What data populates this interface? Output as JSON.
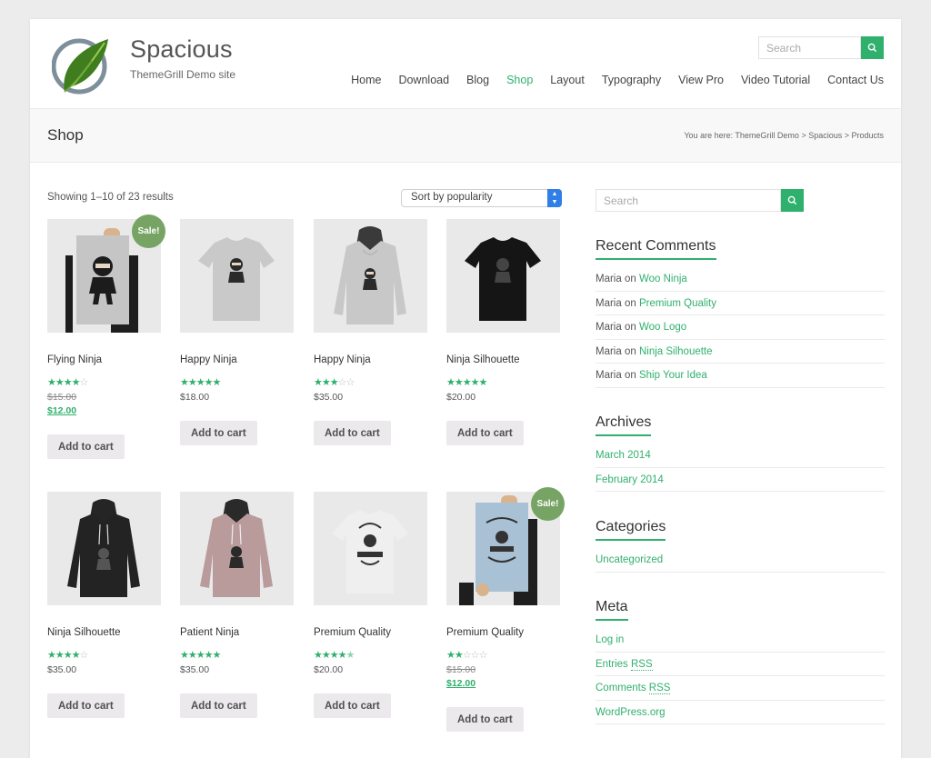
{
  "site": {
    "title": "Spacious",
    "description": "ThemeGrill Demo site"
  },
  "header_search": {
    "placeholder": "Search"
  },
  "nav": [
    {
      "label": "Home",
      "active": false
    },
    {
      "label": "Download",
      "active": false
    },
    {
      "label": "Blog",
      "active": false
    },
    {
      "label": "Shop",
      "active": true
    },
    {
      "label": "Layout",
      "active": false
    },
    {
      "label": "Typography",
      "active": false
    },
    {
      "label": "View Pro",
      "active": false
    },
    {
      "label": "Video Tutorial",
      "active": false
    },
    {
      "label": "Contact Us",
      "active": false
    }
  ],
  "page": {
    "title": "Shop",
    "breadcrumb": "You are here: ThemeGrill Demo > Spacious > Products"
  },
  "shop": {
    "result_count": "Showing 1–10 of 23 results",
    "sort_selected": "Sort by popularity"
  },
  "products": [
    {
      "name": "Flying Ninja",
      "rating": 4,
      "old_price": "$15.00",
      "price": "$12.00",
      "on_sale": true,
      "sale_label": "Sale!",
      "image": "poster-ninja"
    },
    {
      "name": "Happy Ninja",
      "rating": 5,
      "old_price": "",
      "price": "$18.00",
      "on_sale": false,
      "image": "grey-tshirt"
    },
    {
      "name": "Happy Ninja",
      "rating": 3,
      "old_price": "",
      "price": "$35.00",
      "on_sale": false,
      "image": "grey-hoodie"
    },
    {
      "name": "Ninja Silhouette",
      "rating": 5,
      "old_price": "",
      "price": "$20.00",
      "on_sale": false,
      "image": "black-tshirt"
    },
    {
      "name": "Ninja Silhouette",
      "rating": 4,
      "old_price": "",
      "price": "$35.00",
      "on_sale": false,
      "image": "black-hoodie"
    },
    {
      "name": "Patient Ninja",
      "rating": 5,
      "old_price": "",
      "price": "$35.00",
      "on_sale": false,
      "image": "pink-hoodie"
    },
    {
      "name": "Premium Quality",
      "rating": 4.5,
      "old_price": "",
      "price": "$20.00",
      "on_sale": false,
      "image": "white-tshirt"
    },
    {
      "name": "Premium Quality",
      "rating": 2,
      "old_price": "$15.00",
      "price": "$12.00",
      "on_sale": true,
      "sale_label": "Sale!",
      "image": "poster-woo"
    }
  ],
  "add_to_cart_label": "Add to cart",
  "sidebar": {
    "search_placeholder": "Search",
    "recent_comments": {
      "title": "Recent Comments",
      "items": [
        {
          "author": "Maria",
          "on": "on",
          "post": "Woo Ninja"
        },
        {
          "author": "Maria",
          "on": "on",
          "post": "Premium Quality"
        },
        {
          "author": "Maria",
          "on": "on",
          "post": "Woo Logo"
        },
        {
          "author": "Maria",
          "on": "on",
          "post": "Ninja Silhouette"
        },
        {
          "author": "Maria",
          "on": "on",
          "post": "Ship Your Idea"
        }
      ]
    },
    "archives": {
      "title": "Archives",
      "items": [
        "March 2014",
        "February 2014"
      ]
    },
    "categories": {
      "title": "Categories",
      "items": [
        "Uncategorized"
      ]
    },
    "meta": {
      "title": "Meta",
      "items": [
        {
          "text": "Log in"
        },
        {
          "text": "Entries ",
          "abbr": "RSS"
        },
        {
          "text": "Comments ",
          "abbr": "RSS"
        },
        {
          "text": "WordPress.org"
        }
      ]
    }
  },
  "colors": {
    "accent": "#30b06d",
    "sale_badge": "#77a464",
    "button_bg": "#ebe9eb"
  }
}
